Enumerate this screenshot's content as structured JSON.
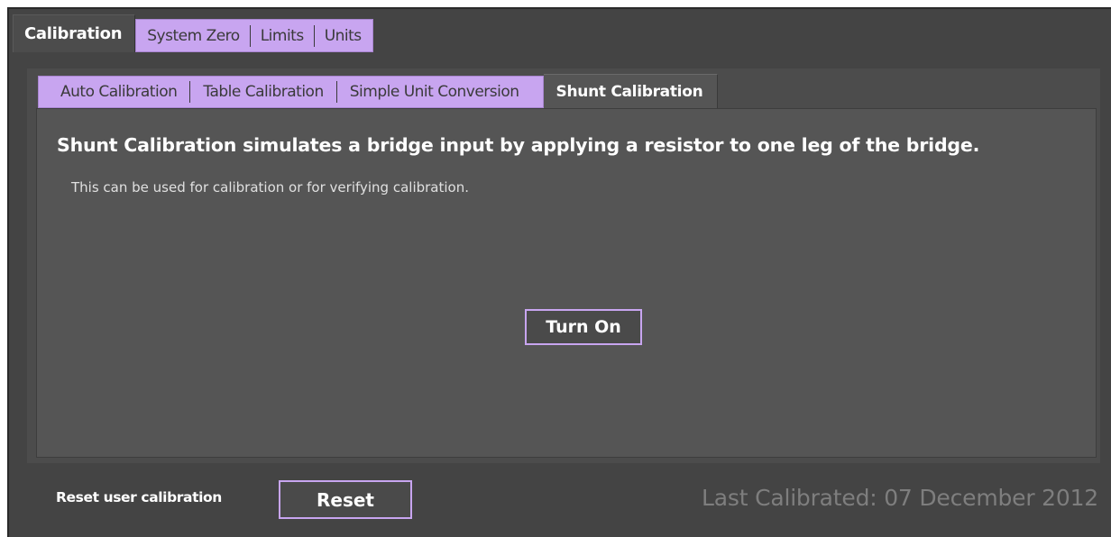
{
  "top_tabs": {
    "active": "Calibration",
    "inactive": [
      "System Zero",
      "Limits",
      "Units"
    ]
  },
  "sub_tabs": {
    "inactive": [
      "Auto Calibration",
      "Table Calibration",
      "Simple Unit Conversion"
    ],
    "active": "Shunt Calibration"
  },
  "content": {
    "headline": "Shunt Calibration simulates a bridge input by applying a resistor to one leg of the bridge.",
    "subline": "This can be used for calibration or for verifying calibration.",
    "turn_on_label": "Turn On"
  },
  "footer": {
    "reset_label": "Reset user calibration",
    "reset_button": "Reset",
    "last_calibrated": "Last Calibrated: 07 December 2012"
  },
  "colors": {
    "accent": "#c8a5f0",
    "background": "#444444",
    "panel": "#555555"
  }
}
